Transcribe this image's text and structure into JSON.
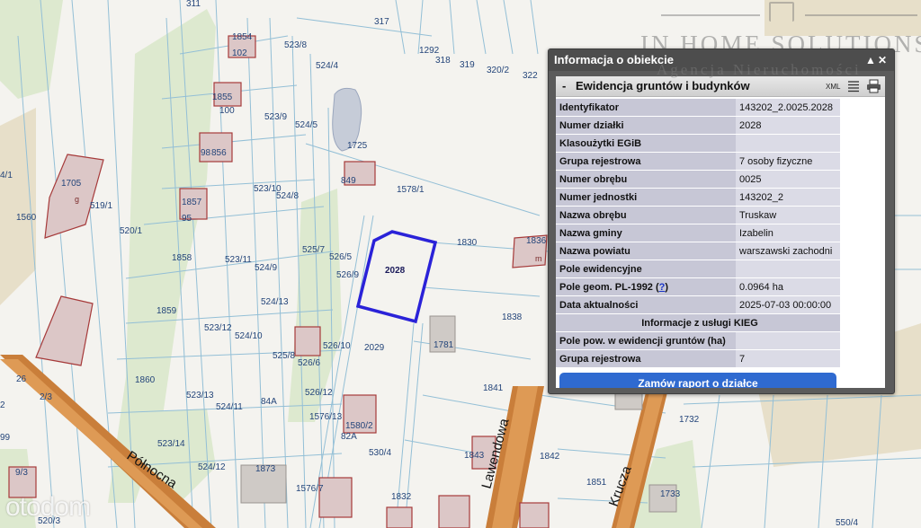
{
  "map": {
    "parcel_labels": [
      "311",
      "317",
      "1292",
      "318",
      "319",
      "320/2",
      "322",
      "1854",
      "102",
      "523/8",
      "524/4",
      "1855",
      "100",
      "523/9",
      "524/5",
      "1725",
      "98",
      "856",
      "849",
      "1705",
      "g",
      "1857",
      "95",
      "523/10",
      "524/8",
      "1578/1",
      "4/1",
      "519/1",
      "1560",
      "520/1",
      "1858",
      "523/11",
      "525/7",
      "526/5",
      "524/9",
      "526/9",
      "1830",
      "1836",
      "m",
      "524/13",
      "1859",
      "523/12",
      "524/10",
      "526/10",
      "2029",
      "1781",
      "1838",
      "525/8",
      "526/6",
      "1860",
      "523/13",
      "524/11",
      "84A",
      "526/12",
      "1841",
      "1576/13",
      "1580/2",
      "82A",
      "1732",
      "523/14",
      "530/4",
      "1843",
      "1842",
      "524/12",
      "1873",
      "1576/7",
      "1851",
      "1733",
      "1832",
      "2/3",
      "9/3",
      "520/3",
      "99",
      "550/4",
      "26",
      "2"
    ],
    "selected_parcel_label": "2028",
    "road_labels": [
      "Północna",
      "Lawendowa",
      "Krucza"
    ],
    "selection_color": "#2a22d8"
  },
  "watermark": {
    "line1": "IN HOME SOLUTIONS",
    "line2": "Agencja Nieruchomości",
    "brand": "otodom"
  },
  "panel": {
    "title": "Informacja o obiekcie",
    "controls": [
      "▲",
      "✕"
    ],
    "section_title": "Ewidencja gruntów i budynków",
    "section_toggle": "-",
    "xml_label": "XML",
    "rows": [
      {
        "key": "Identyfikator",
        "value": "143202_2.0025.2028"
      },
      {
        "key": "Numer działki",
        "value": "2028"
      },
      {
        "key": "Klasoużytki EGiB",
        "value": ""
      },
      {
        "key": "Grupa rejestrowa",
        "value": "7 osoby fizyczne"
      },
      {
        "key": "Numer obrębu",
        "value": "0025"
      },
      {
        "key": "Numer jednostki",
        "value": "143202_2"
      },
      {
        "key": "Nazwa obrębu",
        "value": "Truskaw"
      },
      {
        "key": "Nazwa gminy",
        "value": "Izabelin"
      },
      {
        "key": "Nazwa powiatu",
        "value": "warszawski zachodni"
      },
      {
        "key": "Pole ewidencyjne",
        "value": ""
      },
      {
        "key": "Pole geom. PL-1992",
        "help": "?",
        "value": "0.0964 ha"
      },
      {
        "key": "Data aktualności",
        "value": "2025-07-03 00:00:00"
      }
    ],
    "subheader": "Informacje z usługi KIEG",
    "rows2": [
      {
        "key": "Pole pow. w ewidencji gruntów (ha)",
        "value": ""
      },
      {
        "key": "Grupa rejestrowa",
        "value": "7"
      }
    ],
    "order_button": "Zamów raport o działce"
  }
}
